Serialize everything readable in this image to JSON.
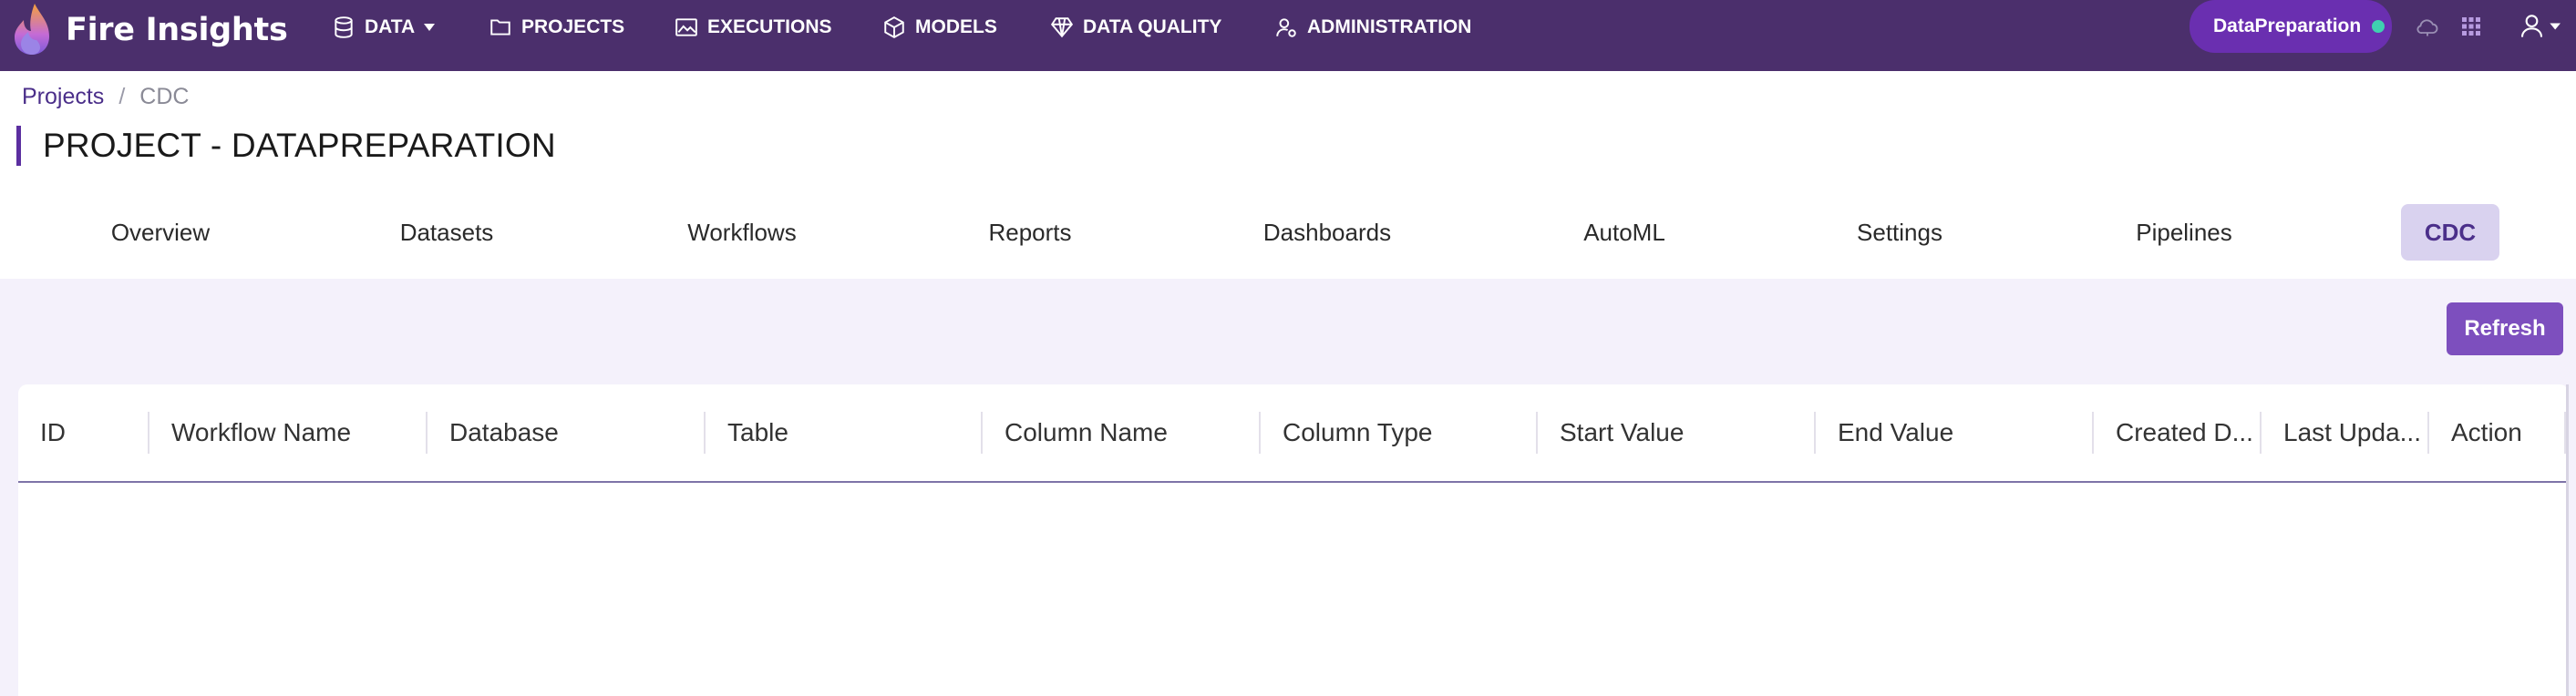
{
  "app": {
    "name": "Fire Insights"
  },
  "nav": [
    {
      "label": "DATA",
      "icon": "database-icon",
      "dropdown": true
    },
    {
      "label": "PROJECTS",
      "icon": "folder-icon"
    },
    {
      "label": "EXECUTIONS",
      "icon": "chart-image-icon"
    },
    {
      "label": "MODELS",
      "icon": "cube-icon"
    },
    {
      "label": "DATA QUALITY",
      "icon": "diamond-icon"
    },
    {
      "label": "ADMINISTRATION",
      "icon": "user-gear-icon"
    }
  ],
  "project_selector": {
    "label": "DataPreparation",
    "status_color": "#3fd0b0"
  },
  "top_icons": [
    "cloud-icon",
    "apps-grid-icon",
    "user-menu-icon"
  ],
  "breadcrumb": {
    "link": "Projects",
    "separator": "/",
    "current": "CDC"
  },
  "page_title": "PROJECT - DATAPREPARATION",
  "tabs": [
    "Overview",
    "Datasets",
    "Workflows",
    "Reports",
    "Dashboards",
    "AutoML",
    "Settings",
    "Pipelines",
    "CDC"
  ],
  "active_tab": "CDC",
  "toolbar": {
    "refresh_label": "Refresh"
  },
  "table": {
    "columns": [
      "ID",
      "Workflow Name",
      "Database",
      "Table",
      "Column Name",
      "Column Type",
      "Start Value",
      "End Value",
      "Created D...",
      "Last Upda...",
      "Action"
    ],
    "rows": []
  },
  "colors": {
    "topbar": "#4b2f6c",
    "accent": "#7d4fbe",
    "active_tab_bg": "#d9d2ef",
    "content_bg": "#f4f1fb"
  }
}
